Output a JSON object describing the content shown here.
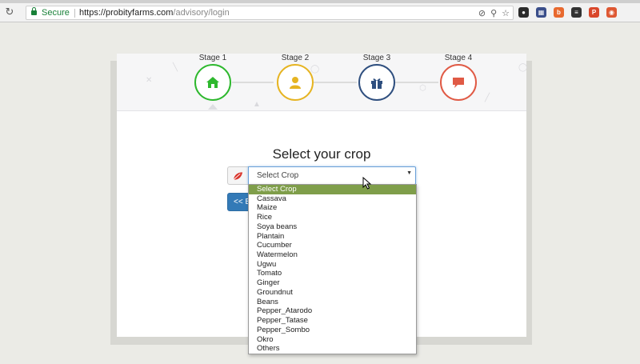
{
  "browser": {
    "secure_label": "Secure",
    "url_scheme": "https://",
    "url_host": "probityfarms.com",
    "url_path": "/advisory/login",
    "nav": {
      "back_icon": "arrow-left-icon",
      "forward_icon": "arrow-right-icon",
      "reload_icon": "reload-icon"
    },
    "extensions": [
      {
        "name": "ext-dark-icon",
        "color": "#2b2b2b",
        "glyph": "●"
      },
      {
        "name": "ext-clapper-icon",
        "color": "#3a4e8a",
        "glyph": "▦"
      },
      {
        "name": "ext-rss-icon",
        "color": "#e8692f",
        "glyph": "b"
      },
      {
        "name": "ext-stack-icon",
        "color": "#333333",
        "glyph": "≡"
      },
      {
        "name": "ext-p-icon",
        "color": "#d9472b",
        "glyph": "P"
      },
      {
        "name": "ext-duck-icon",
        "color": "#de5833",
        "glyph": "◉"
      }
    ]
  },
  "steps": [
    {
      "label": "Stage 1",
      "icon": "home-icon",
      "color": "#2eb82e"
    },
    {
      "label": "Stage 2",
      "icon": "user-icon",
      "color": "#e6b422"
    },
    {
      "label": "Stage 3",
      "icon": "gift-icon",
      "color": "#2f4f7f"
    },
    {
      "label": "Stage 4",
      "icon": "chat-icon",
      "color": "#e05a45"
    }
  ],
  "form": {
    "heading": "Select your crop",
    "addon_icon": "leaf-icon",
    "select_value": "Select Crop",
    "back_label": "<< Back"
  },
  "dropdown": {
    "selected_color": "#7f9e4a",
    "options": [
      "Select Crop",
      "Cassava",
      "Maize",
      "Rice",
      "Soya beans",
      "Plantain",
      "Cucumber",
      "Watermelon",
      "Ugwu",
      "Tomato",
      "Ginger",
      "Groundnut",
      "Beans",
      "Pepper_Atarodo",
      "Pepper_Tatase",
      "Pepper_Sombo",
      "Okro",
      "Others"
    ]
  }
}
